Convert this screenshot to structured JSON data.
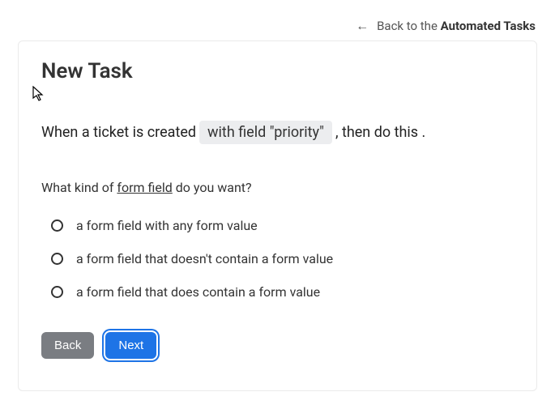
{
  "header": {
    "back_arrow": "←",
    "back_text_prefix": "Back to the ",
    "back_text_bold": "Automated Tasks"
  },
  "card": {
    "title": "New Task",
    "rule": {
      "prefix": "When a ticket is created",
      "token": "with field \"priority\"",
      "suffix": ", then do this ."
    },
    "question": {
      "before": "What kind of ",
      "underlined": "form field",
      "after": " do you want?"
    },
    "options": [
      {
        "label": "a form field with any form value"
      },
      {
        "label": "a form field that doesn't contain a form value"
      },
      {
        "label": "a form field that does contain a form value"
      }
    ],
    "buttons": {
      "back": "Back",
      "next": "Next"
    }
  }
}
